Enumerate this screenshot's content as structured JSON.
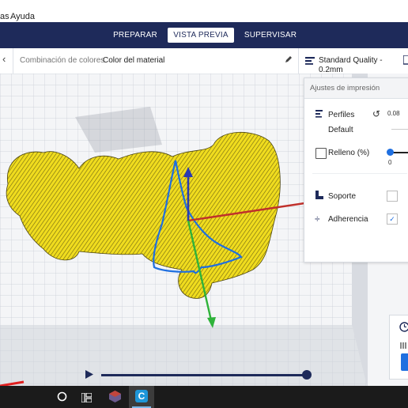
{
  "menu": {
    "items": [
      "as",
      "Ayuda"
    ]
  },
  "stages": [
    {
      "label": "PREPARAR",
      "active": false
    },
    {
      "label": "VISTA PREVIA",
      "active": true
    },
    {
      "label": "SUPERVISAR",
      "active": false
    }
  ],
  "toolbar": {
    "view_type_label": "Combinación de colores",
    "view_type_value": "Color del material",
    "profile_label": "Standard Quality - 0.2mm"
  },
  "settings": {
    "header": "Ajustes de impresión",
    "profiles_label": "Perfiles",
    "profile_default": "Default",
    "layer_height": "0.08",
    "infill_label": "Relleno (%)",
    "infill_value": "0",
    "support_label": "Soporte",
    "support_checked": false,
    "adhesion_label": "Adherencia",
    "adhesion_checked": true
  },
  "colors": {
    "accent": "#1e2a5a",
    "model": "#f0dc1e",
    "x_axis": "#c0302b",
    "y_axis": "#2fb33a",
    "z_axis": "#2b3bb0",
    "toolpath": "#1f6fe0"
  },
  "icons": {
    "back": "chevron-left-icon",
    "edit": "pencil-icon",
    "profile": "sliders-icon",
    "reset": "reset-icon",
    "support": "support-icon",
    "adhesion": "adhesion-icon",
    "play": "play-icon",
    "windows": "windows-search-icon",
    "taskview": "task-view-icon",
    "app_cura": "cura-app-icon"
  }
}
